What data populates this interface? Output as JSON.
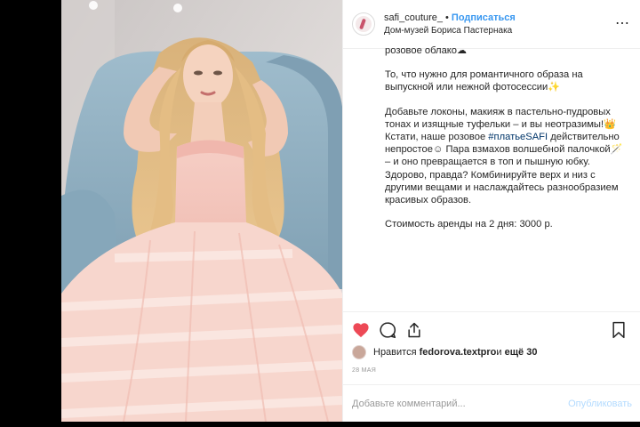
{
  "header": {
    "username": "safi_couture_",
    "separator": "•",
    "follow_label": "Подписаться",
    "location": "Дом-музей Бориса Пастернака",
    "more_icon": "more-icon"
  },
  "caption": {
    "p1": "розовое облако☁",
    "p2": "То, что нужно для романтичного образа на выпускной или нежной фотосессии✨",
    "p3_before": "Добавьте локоны, макияж в пастельно-пудровых тонах и изящные туфельки – и вы неотразимы!👑 Кстати, наше розовое ",
    "p3_tag": "#платьеSAFI",
    "p3_after": " действительно непростое☺ Пара взмахов волшебной палочкой🪄 – и оно превращается в топ и пышную юбку. Здорово, правда? Комбинируйте верх и низ с другими вещами и наслаждайтесь разнообразием красивых образов.",
    "p4": "Стоимость аренды на 2 дня: 3000 р."
  },
  "actions": {
    "like_icon": "heart-icon",
    "comment_icon": "comment-icon",
    "share_icon": "share-icon",
    "save_icon": "bookmark-icon"
  },
  "likes": {
    "prefix": "Нравится ",
    "user": "fedorova.textpro",
    "middle": " и ",
    "rest": "ещё 30"
  },
  "date": "28 МАЯ",
  "comment": {
    "placeholder": "Добавьте комментарий...",
    "publish_label": "Опубликовать"
  },
  "colors": {
    "like_red": "#ed4956",
    "follow_blue": "#3897f0",
    "hashtag": "#003569"
  }
}
